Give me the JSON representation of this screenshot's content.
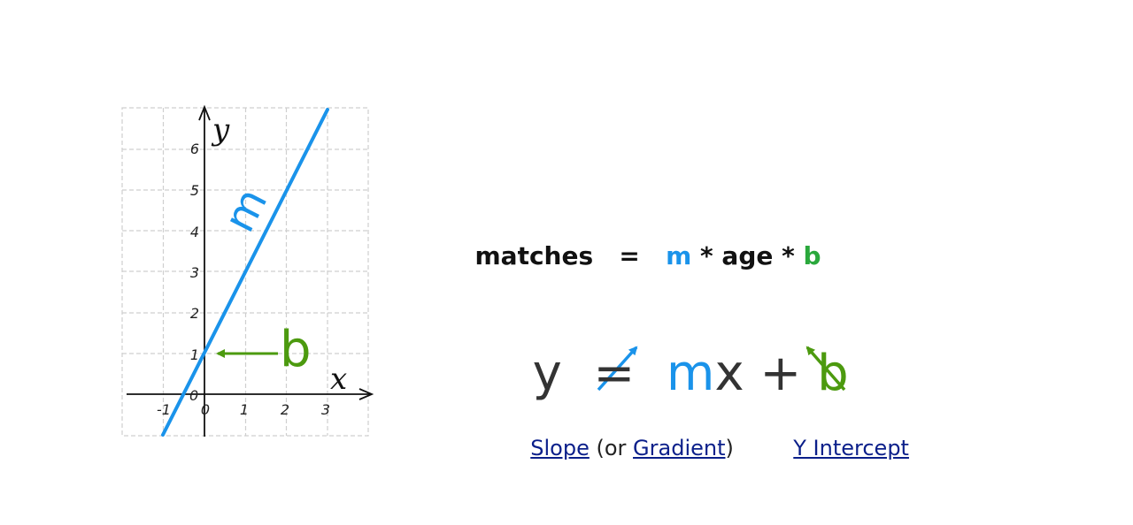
{
  "colors": {
    "slope": "#1a93ea",
    "intercept": "#4c9a0f",
    "intercept_bold": "#2aa83c",
    "text": "#111111",
    "link": "#0b1f8a",
    "grid": "#cfcfcf"
  },
  "graph": {
    "axis_x_name": "x",
    "axis_y_name": "y",
    "x_ticks": [
      "-1",
      "0",
      "1",
      "2",
      "3"
    ],
    "y_ticks": [
      "1",
      "2",
      "3",
      "4",
      "5",
      "6"
    ],
    "origin_label": "0",
    "slope_symbol": "m",
    "intercept_symbol": "b",
    "line": {
      "slope": 2,
      "intercept": 1
    }
  },
  "formula1": {
    "lhs": "matches",
    "eq": "   =   ",
    "m": "m",
    "middle": " * age * ",
    "b": "b"
  },
  "formula2": {
    "y": "y",
    "eq": "  =  ",
    "m": "m",
    "x": "x",
    "plus": " + ",
    "b": "b"
  },
  "captions": {
    "slope_link": "Slope",
    "or_text": " (or ",
    "gradient_link": "Gradient",
    "close_paren": ")",
    "intercept_link": "Y Intercept"
  }
}
